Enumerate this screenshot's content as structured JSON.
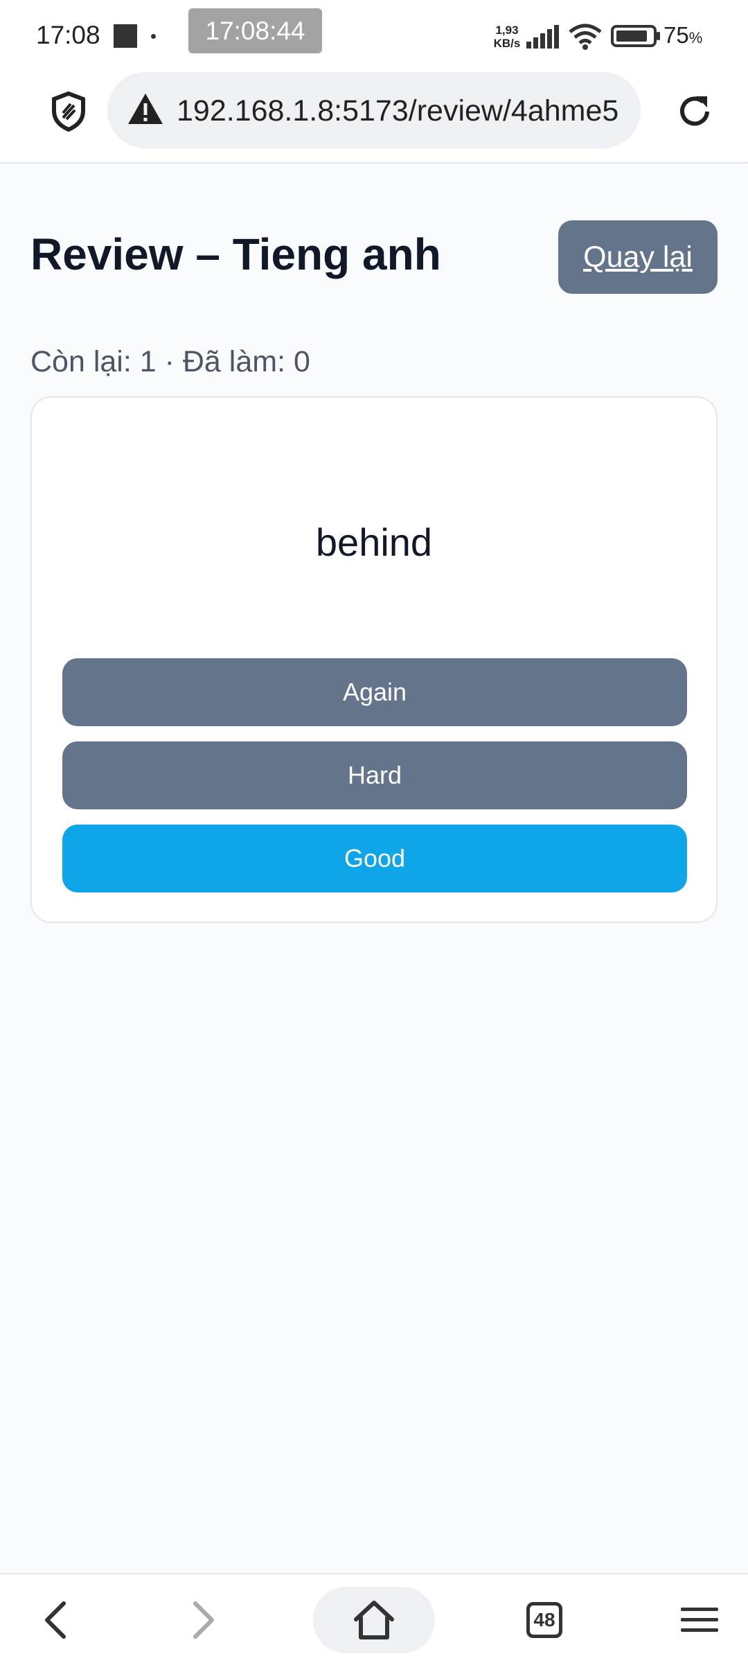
{
  "status_bar": {
    "time": "17:08",
    "clock_overlay": "17:08:44",
    "net_speed_value": "1,93",
    "net_speed_unit": "KB/s",
    "battery_percent": "75",
    "battery_unit": "%"
  },
  "browser": {
    "url": "192.168.1.8:5173/review/4ahme5",
    "tab_count": "48"
  },
  "page": {
    "title": "Review – Tieng anh",
    "back_label": "Quay lại",
    "progress": "Còn lại: 1 · Đã làm: 0"
  },
  "card": {
    "word": "behind",
    "buttons": {
      "again": "Again",
      "hard": "Hard",
      "good": "Good"
    }
  },
  "colors": {
    "primary_button": "#0ea5e9",
    "secondary_button": "#64748b",
    "page_background": "#f8fafc"
  },
  "icons": {
    "shield": "shield-icon",
    "warning": "warning-icon",
    "reload": "reload-icon",
    "back": "back-arrow-icon",
    "forward": "forward-arrow-icon",
    "home": "home-icon",
    "menu": "menu-icon"
  }
}
